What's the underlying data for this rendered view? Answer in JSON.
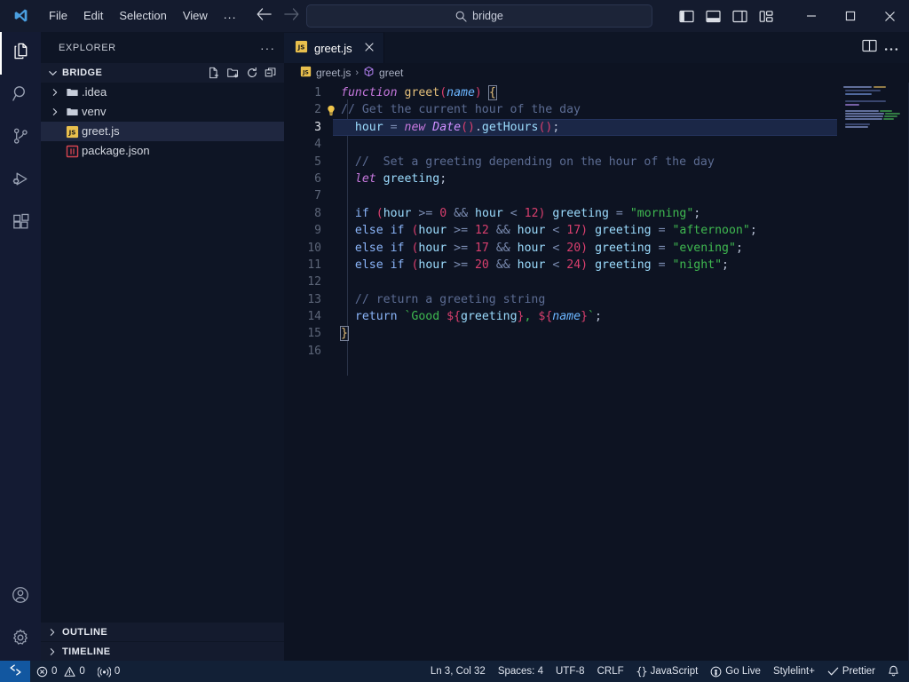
{
  "titlebar": {
    "logo_icon": "vscode-logo-icon",
    "menus": [
      "File",
      "Edit",
      "Selection",
      "View",
      "..."
    ],
    "nav": {
      "back_icon": "arrow-left-icon",
      "forward_icon": "arrow-right-icon"
    },
    "search": {
      "icon": "search-icon",
      "value": "bridge",
      "placeholder": "Search"
    },
    "layout_buttons": [
      {
        "name": "toggle-primary-sidebar-icon",
        "title": "Toggle Primary Side Bar"
      },
      {
        "name": "toggle-panel-icon",
        "title": "Toggle Panel"
      },
      {
        "name": "toggle-secondary-sidebar-icon",
        "title": "Toggle Secondary Side Bar"
      },
      {
        "name": "customize-layout-icon",
        "title": "Customize Layout"
      }
    ],
    "window_buttons": {
      "minimize": "–",
      "maximize": "□",
      "close": "✕"
    }
  },
  "activitybar": {
    "top": [
      {
        "name": "explorer",
        "icon": "files-icon",
        "active": true
      },
      {
        "name": "search",
        "icon": "search-icon",
        "active": false
      },
      {
        "name": "source-control",
        "icon": "source-control-icon",
        "active": false
      },
      {
        "name": "run-and-debug",
        "icon": "run-debug-icon",
        "active": false
      },
      {
        "name": "extensions",
        "icon": "extensions-icon",
        "active": false
      }
    ],
    "bottom": [
      {
        "name": "accounts",
        "icon": "account-icon"
      },
      {
        "name": "manage",
        "icon": "gear-icon"
      }
    ]
  },
  "sidebar": {
    "title": "EXPLORER",
    "more_actions": "···",
    "folder": {
      "name": "BRIDGE",
      "expanded": true,
      "actions": [
        "new-file-icon",
        "new-folder-icon",
        "refresh-icon",
        "collapse-all-icon"
      ]
    },
    "tree": [
      {
        "label": ".idea",
        "type": "folder",
        "expanded": false,
        "selected": false,
        "icon": "folder-icon"
      },
      {
        "label": "venv",
        "type": "folder",
        "expanded": false,
        "selected": false,
        "icon": "folder-icon"
      },
      {
        "label": "greet.js",
        "type": "file",
        "selected": true,
        "icon": "js-file-icon"
      },
      {
        "label": "package.json",
        "type": "file",
        "selected": false,
        "icon": "json-file-icon"
      }
    ],
    "bottom_sections": [
      {
        "label": "OUTLINE",
        "expanded": false
      },
      {
        "label": "TIMELINE",
        "expanded": false
      }
    ]
  },
  "editor": {
    "tabs": [
      {
        "label": "greet.js",
        "icon": "js-file-icon",
        "active": true,
        "close_icon": "close-icon"
      }
    ],
    "tab_actions": [
      "split-editor-icon",
      "more-actions-icon"
    ],
    "breadcrumb": [
      {
        "label": "greet.js",
        "icon": "js-file-icon"
      },
      {
        "label": "greet",
        "icon": "symbol-method-icon"
      }
    ],
    "breadcrumb_separator": "›",
    "current_line": 3,
    "lines": [
      {
        "n": 1,
        "text": "function greet(name) {"
      },
      {
        "n": 2,
        "text": "// Get the current hour of the day",
        "lightbulb": true
      },
      {
        "n": 3,
        "text": "hour = new Date().getHours();"
      },
      {
        "n": 4,
        "text": ""
      },
      {
        "n": 5,
        "text": "//  Set a greeting depending on the hour of the day"
      },
      {
        "n": 6,
        "text": "let greeting;"
      },
      {
        "n": 7,
        "text": ""
      },
      {
        "n": 8,
        "text": "if (hour >= 0 && hour < 12) greeting = \"morning\";"
      },
      {
        "n": 9,
        "text": "else if (hour >= 12 && hour < 17) greeting = \"afternoon\";"
      },
      {
        "n": 10,
        "text": "else if (hour >= 17 && hour < 20) greeting = \"evening\";"
      },
      {
        "n": 11,
        "text": "else if (hour >= 20 && hour < 24) greeting = \"night\";"
      },
      {
        "n": 12,
        "text": ""
      },
      {
        "n": 13,
        "text": "// return a greeting string"
      },
      {
        "n": 14,
        "text": "return `Good ${greeting}, ${name}`;"
      },
      {
        "n": 15,
        "text": "}"
      },
      {
        "n": 16,
        "text": ""
      }
    ]
  },
  "statusbar": {
    "remote_icon": "remote-window-icon",
    "left": [
      {
        "name": "problems-errors",
        "icon": "error-icon",
        "label": "0"
      },
      {
        "name": "problems-warnings",
        "icon": "warning-icon",
        "label": "0"
      },
      {
        "name": "ports",
        "icon": "ports-icon",
        "label": "0"
      }
    ],
    "right": [
      {
        "name": "editor-position",
        "label": "Ln 3, Col 32"
      },
      {
        "name": "editor-indentation",
        "label": "Spaces: 4"
      },
      {
        "name": "editor-encoding",
        "label": "UTF-8"
      },
      {
        "name": "editor-eol",
        "label": "CRLF"
      },
      {
        "name": "editor-language",
        "label": "JavaScript",
        "icon": "braces-icon"
      },
      {
        "name": "go-live",
        "label": "Go Live",
        "icon": "broadcast-icon"
      },
      {
        "name": "stylelint",
        "label": "Stylelint+"
      },
      {
        "name": "prettier",
        "label": "Prettier",
        "icon": "check-icon"
      },
      {
        "name": "notifications",
        "label": "",
        "icon": "bell-icon"
      }
    ]
  },
  "colors": {
    "titlebar_bg": "#141b2e",
    "activitybar_bg": "#141b33",
    "sidebar_bg": "#0e1525",
    "editor_bg": "#0d1322",
    "statusbar_bg": "#122036",
    "remote_badge": "#1257a0",
    "current_line": "#1b2747",
    "selection": "#1f2740",
    "accent": "#8ab4f8"
  }
}
